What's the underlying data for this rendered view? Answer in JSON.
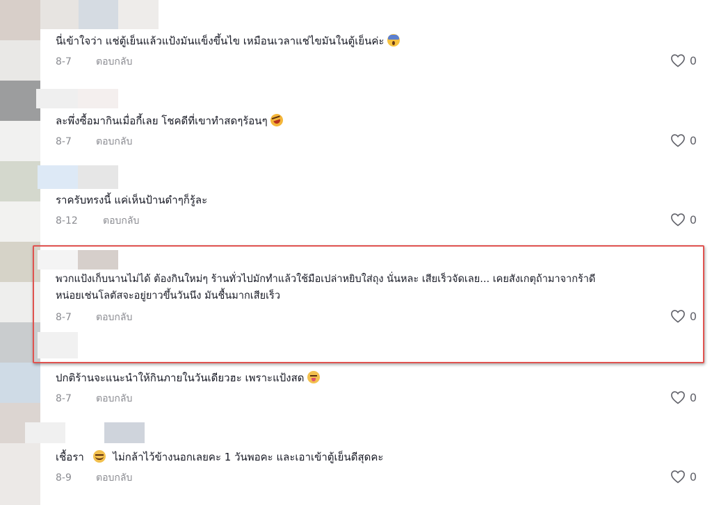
{
  "comments": [
    {
      "text": "นี่เข้าใจว่า แช่ตู้เย็นแล้วแป้งมันแข็งขึ้นไข เหมือนเวลาแช่ไขมันในตู้เย็นค่ะ",
      "emoji": "face-screaming-in-fear-icon",
      "date": "8-7",
      "reply_label": "ตอบกลับ",
      "likes": "0"
    },
    {
      "text": "ละพึ่งซื้อมากินเมื่อกี้เลย โชคดีที่เขาทำสดๆร้อนๆ",
      "emoji": "rolling-on-floor-laughing-icon",
      "date": "8-7",
      "reply_label": "ตอบกลับ",
      "likes": "0"
    },
    {
      "text": "ราครับทรงนี้ แค่เห็นป้านดำๆก็รู้ละ",
      "date": "8-12",
      "reply_label": "ตอบกลับ",
      "likes": "0"
    },
    {
      "text_line1": "พวกแป้งเก็บนานไม่ได้ ต้องกินใหม่ๆ ร้านทั่วไปมักทำแล้วใช้มือเปล่าหยิบใส่ถุง นั่นหละ เสียเร็วจัดเลย... เคยสังเกตุถ้ามาจากร้าดี",
      "text_line2": "หน่อยเช่นโลตัสจะอยู่ยาวขึ้นวันนึง มันชื้นมากเสียเร็ว",
      "date": "8-7",
      "reply_label": "ตอบกลับ",
      "likes": "0",
      "highlighted": true
    },
    {
      "text": "ปกติร้านจะแนะนำให้กินภายในวันเดียวฮะ เพราะแป้งสด",
      "emoji": "face-savoring-food-icon",
      "date": "8-7",
      "reply_label": "ตอบกลับ",
      "likes": "0"
    },
    {
      "text_before": "เชื้อรา",
      "text_after": "ไม่กล้าไว้ข้างนอกเลยคะ 1 วันพอคะ และเอาเข้าตู้เย็นดีสุดคะ",
      "emoji": "drooling-face-icon",
      "date": "8-9",
      "reply_label": "ตอบกลับ",
      "likes": "0"
    }
  ],
  "colors": {
    "highlight_border": "#e0524f",
    "meta_text": "#8a8b91",
    "body_text": "#161823"
  }
}
